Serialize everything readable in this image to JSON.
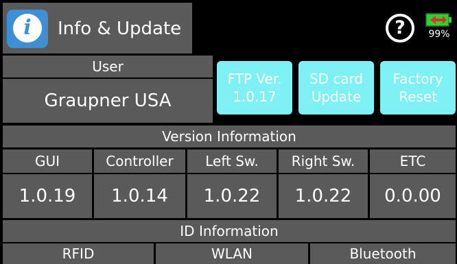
{
  "header": {
    "title": "Info & Update",
    "app_icon_glyph": "i",
    "help_glyph": "?",
    "battery_percent": "99%",
    "battery_level": 0.99
  },
  "user": {
    "label": "User",
    "name": "Graupner USA"
  },
  "buttons": {
    "ftp": {
      "line1": "FTP Ver.",
      "line2": "1.0.17"
    },
    "sd": {
      "line1": "SD card",
      "line2": "Update"
    },
    "reset": {
      "line1": "Factory",
      "line2": "Reset"
    }
  },
  "version_info": {
    "header": "Version Information",
    "columns": [
      {
        "label": "GUI",
        "value": "1.0.19"
      },
      {
        "label": "Controller",
        "value": "1.0.14"
      },
      {
        "label": "Left Sw.",
        "value": "1.0.22"
      },
      {
        "label": "Right Sw.",
        "value": "1.0.22"
      },
      {
        "label": "ETC",
        "value": "0.0.00"
      }
    ]
  },
  "id_info": {
    "header": "ID Information",
    "columns": [
      "RFID",
      "WLAN",
      "Bluetooth"
    ]
  },
  "colors": {
    "background": "#000000",
    "panel": "#5a5a5a",
    "button_cyan": "#7ff0f3",
    "app_icon_blue": "#3f8fd4",
    "battery_green": "#2fd12f",
    "battery_red": "#e03030"
  },
  "icons": {
    "app": "info-icon",
    "help": "help-icon",
    "battery": "battery-icon"
  }
}
